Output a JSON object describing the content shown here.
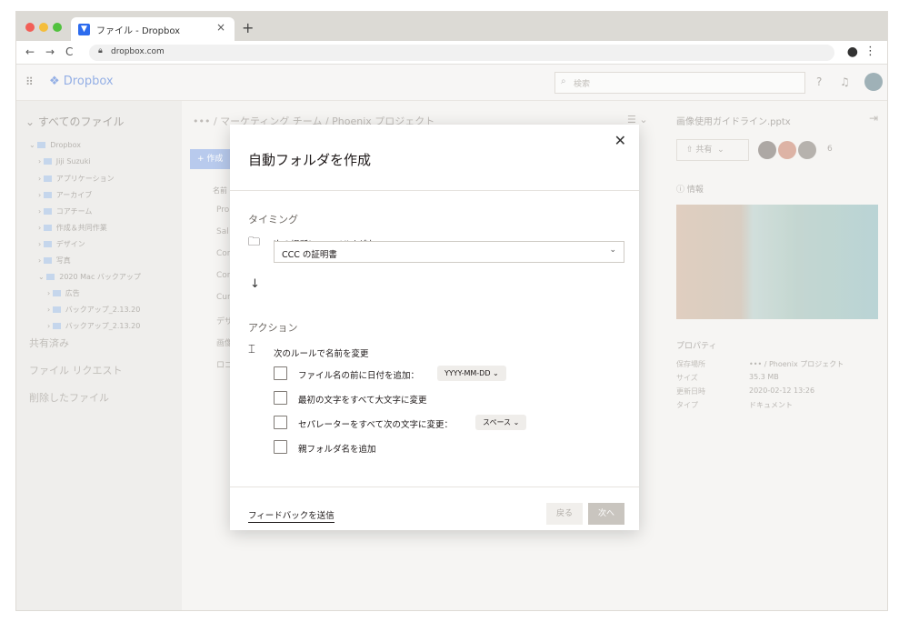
{
  "browser": {
    "tab_title": "ファイル - Dropbox",
    "tab_close": "×",
    "new_tab": "+",
    "url": "dropbox.com",
    "nav_back": "←",
    "nav_forward": "→",
    "nav_reload": "C"
  },
  "header": {
    "logo_text": "Dropbox",
    "search_placeholder": "検索"
  },
  "sidebar": {
    "title": "すべてのファイル",
    "tree": [
      {
        "label": "Dropbox",
        "indent": 0
      },
      {
        "label": "Jiji Suzuki",
        "indent": 1
      },
      {
        "label": "アプリケーション",
        "indent": 1
      },
      {
        "label": "アーカイブ",
        "indent": 1
      },
      {
        "label": "コアチーム",
        "indent": 1
      },
      {
        "label": "作成＆共同作業",
        "indent": 1
      },
      {
        "label": "デザイン",
        "indent": 1
      },
      {
        "label": "写真",
        "indent": 1
      },
      {
        "label": "2020 Mac バックアップ",
        "indent": 1
      },
      {
        "label": "広告",
        "indent": 2
      },
      {
        "label": "バックアップ_2.13.20",
        "indent": 2
      },
      {
        "label": "バックアップ_2.13.20",
        "indent": 2
      }
    ],
    "links": [
      "共有済み",
      "ファイル リクエスト",
      "削除したファイル"
    ]
  },
  "main": {
    "breadcrumb": "••• / マーケティング チーム / Phoenix プロジェクト",
    "create_label": "作成",
    "name_header": "名前 ↑",
    "rows": [
      "Pro",
      "Sal",
      "Cor",
      "Cor",
      "Cur",
      "デザ",
      "画像",
      "ロゴ"
    ]
  },
  "details": {
    "title": "画像使用ガイドライン.pptx",
    "share_label": "共有",
    "member_count": "6",
    "info_label": "情報",
    "properties_title": "プロパティ",
    "properties": [
      {
        "key": "保存場所",
        "value": "••• / Phoenix プロジェクト"
      },
      {
        "key": "サイズ",
        "value": "35.3 MB"
      },
      {
        "key": "更新日時",
        "value": "2020-02-12 13:26"
      },
      {
        "key": "タイプ",
        "value": "ドキュメント"
      }
    ]
  },
  "modal": {
    "title": "自動フォルダを作成",
    "timing_label": "タイミング",
    "timing_line": "次の場所にファイルを追加：",
    "timing_select": "CCC の証明書",
    "action_label": "アクション",
    "action_line": "次のルールで名前を変更",
    "options": [
      {
        "label": "ファイル名の前に日付を追加：",
        "pill": "YYYY-MM-DD",
        "checked": false
      },
      {
        "label": "最初の文字をすべて大文字に変更",
        "checked": false
      },
      {
        "label": "セパレーターをすべて次の文字に変更：",
        "pill": "スペース",
        "checked": false
      },
      {
        "label": "親フォルダ名を追加",
        "checked": false
      }
    ],
    "feedback_label": "フィードバックを送信",
    "back_label": "戻る",
    "next_label": "次へ"
  }
}
